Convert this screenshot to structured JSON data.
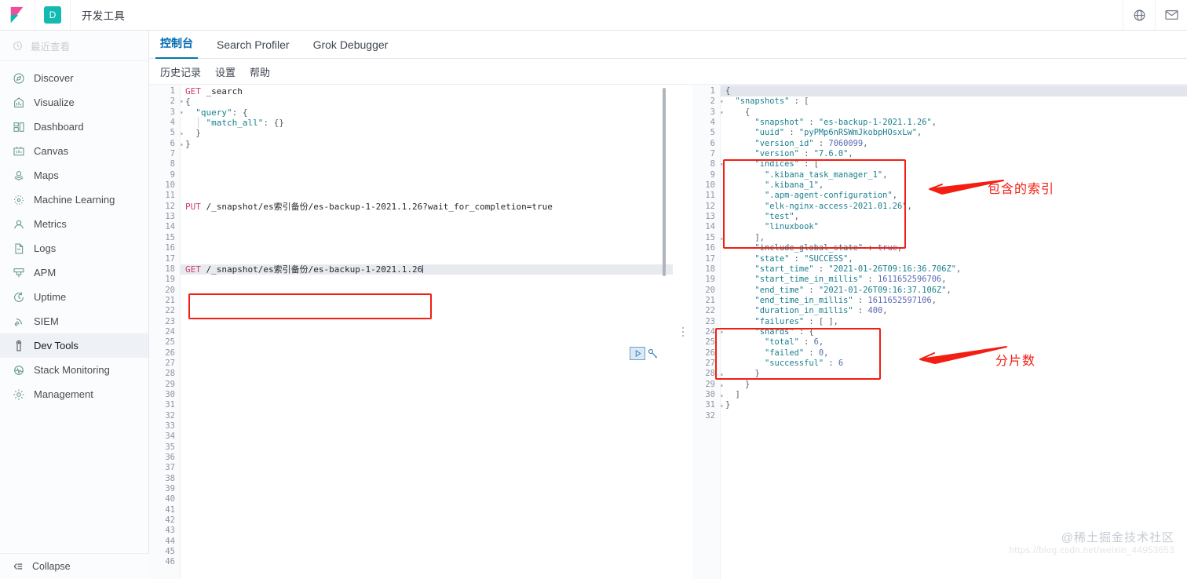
{
  "header": {
    "app_title": "开发工具",
    "space_badge": "D",
    "logo_icon": "kibana-logo-icon",
    "help_icon": "globe-help-icon",
    "mail_icon": "envelope-icon"
  },
  "sidebar": {
    "recent_label": "最近查看",
    "recent_icon": "clock-icon",
    "items": [
      {
        "label": "Discover",
        "icon": "compass-icon",
        "active": false
      },
      {
        "label": "Visualize",
        "icon": "bar-chart-icon",
        "active": false
      },
      {
        "label": "Dashboard",
        "icon": "dashboard-grid-icon",
        "active": false
      },
      {
        "label": "Canvas",
        "icon": "canvas-icon",
        "active": false
      },
      {
        "label": "Maps",
        "icon": "map-marker-icon",
        "active": false
      },
      {
        "label": "Machine Learning",
        "icon": "ml-dots-icon",
        "active": false
      },
      {
        "label": "Metrics",
        "icon": "metrics-gauge-icon",
        "active": false
      },
      {
        "label": "Logs",
        "icon": "logs-icon",
        "active": false
      },
      {
        "label": "APM",
        "icon": "apm-icon",
        "active": false
      },
      {
        "label": "Uptime",
        "icon": "uptime-clock-icon",
        "active": false
      },
      {
        "label": "SIEM",
        "icon": "siem-signal-icon",
        "active": false
      },
      {
        "label": "Dev Tools",
        "icon": "wrench-icon",
        "active": true
      },
      {
        "label": "Stack Monitoring",
        "icon": "monitoring-icon",
        "active": false
      },
      {
        "label": "Management",
        "icon": "gear-icon",
        "active": false
      }
    ],
    "collapse_label": "Collapse",
    "collapse_icon": "collapse-left-icon"
  },
  "tabs": [
    {
      "label": "控制台",
      "active": true
    },
    {
      "label": "Search Profiler",
      "active": false
    },
    {
      "label": "Grok Debugger",
      "active": false
    }
  ],
  "subbar": [
    {
      "label": "历史记录"
    },
    {
      "label": "设置"
    },
    {
      "label": "帮助"
    }
  ],
  "request_editor": {
    "total_visible_lines": 46,
    "lines": [
      {
        "n": 1,
        "fold": "",
        "tokens": [
          {
            "t": "GET ",
            "c": "m"
          },
          {
            "t": "_search",
            "c": "url"
          }
        ]
      },
      {
        "n": 2,
        "fold": "▾",
        "tokens": [
          {
            "t": "{",
            "c": "pun"
          }
        ]
      },
      {
        "n": 3,
        "fold": "▾",
        "tokens": [
          {
            "t": "  \"query\"",
            "c": "key"
          },
          {
            "t": ": {",
            "c": "pun"
          }
        ]
      },
      {
        "n": 4,
        "fold": "",
        "tokens": [
          {
            "t": "  ",
            "c": "pun"
          },
          {
            "t": "│",
            "c": "indent"
          },
          {
            "t": " \"match_all\"",
            "c": "key"
          },
          {
            "t": ": {}",
            "c": "pun"
          }
        ]
      },
      {
        "n": 5,
        "fold": "▴",
        "tokens": [
          {
            "t": "  }",
            "c": "pun"
          }
        ]
      },
      {
        "n": 6,
        "fold": "▴",
        "tokens": [
          {
            "t": "}",
            "c": "pun"
          }
        ]
      },
      {
        "n": 7,
        "fold": "",
        "tokens": []
      },
      {
        "n": 8,
        "fold": "",
        "tokens": []
      },
      {
        "n": 9,
        "fold": "",
        "tokens": []
      },
      {
        "n": 10,
        "fold": "",
        "tokens": []
      },
      {
        "n": 11,
        "fold": "",
        "tokens": []
      },
      {
        "n": 12,
        "fold": "",
        "tokens": [
          {
            "t": "PUT ",
            "c": "m"
          },
          {
            "t": "/_snapshot/es索引备份/es-backup-1-2021.1.26?wait_for_completion=true",
            "c": "url"
          }
        ]
      },
      {
        "n": 13,
        "fold": "",
        "tokens": []
      },
      {
        "n": 14,
        "fold": "",
        "tokens": []
      },
      {
        "n": 15,
        "fold": "",
        "tokens": []
      },
      {
        "n": 16,
        "fold": "",
        "tokens": []
      },
      {
        "n": 17,
        "fold": "",
        "tokens": []
      },
      {
        "n": 18,
        "fold": "",
        "hl": true,
        "caret": true,
        "tokens": [
          {
            "t": "GET ",
            "c": "m"
          },
          {
            "t": "/_snapshot/es索引备份/es-backup-1-2021.1.26",
            "c": "url"
          }
        ]
      },
      {
        "n": 19,
        "fold": "",
        "tokens": []
      },
      {
        "n": 20,
        "fold": "",
        "tokens": []
      },
      {
        "n": 21,
        "fold": "",
        "tokens": []
      },
      {
        "n": 22,
        "fold": "",
        "tokens": []
      },
      {
        "n": 23,
        "fold": "",
        "tokens": []
      },
      {
        "n": 24,
        "fold": "",
        "tokens": []
      },
      {
        "n": 25,
        "fold": "",
        "tokens": []
      },
      {
        "n": 26,
        "fold": "",
        "tokens": []
      },
      {
        "n": 27,
        "fold": "",
        "tokens": []
      },
      {
        "n": 28,
        "fold": "",
        "tokens": []
      },
      {
        "n": 29,
        "fold": "",
        "tokens": []
      },
      {
        "n": 30,
        "fold": "",
        "tokens": []
      },
      {
        "n": 31,
        "fold": "",
        "tokens": []
      },
      {
        "n": 32,
        "fold": "",
        "tokens": []
      },
      {
        "n": 33,
        "fold": "",
        "tokens": []
      },
      {
        "n": 34,
        "fold": "",
        "tokens": []
      },
      {
        "n": 35,
        "fold": "",
        "tokens": []
      },
      {
        "n": 36,
        "fold": "",
        "tokens": []
      },
      {
        "n": 37,
        "fold": "",
        "tokens": []
      },
      {
        "n": 38,
        "fold": "",
        "tokens": []
      },
      {
        "n": 39,
        "fold": "",
        "tokens": []
      },
      {
        "n": 40,
        "fold": "",
        "tokens": []
      },
      {
        "n": 41,
        "fold": "",
        "tokens": []
      },
      {
        "n": 42,
        "fold": "",
        "tokens": []
      },
      {
        "n": 43,
        "fold": "",
        "tokens": []
      },
      {
        "n": 44,
        "fold": "",
        "tokens": []
      },
      {
        "n": 45,
        "fold": "",
        "tokens": []
      },
      {
        "n": 46,
        "fold": "",
        "tokens": []
      }
    ],
    "run_button_icon": "play-triangle-icon",
    "wrench_button_icon": "wrench-icon"
  },
  "response_editor": {
    "lines": [
      {
        "n": 1,
        "fold": "▾",
        "hl": true,
        "tokens": [
          {
            "t": "{",
            "c": "pun"
          }
        ]
      },
      {
        "n": 2,
        "fold": "▾",
        "tokens": [
          {
            "t": "  \"snapshots\"",
            "c": "key"
          },
          {
            "t": " : [",
            "c": "pun"
          }
        ]
      },
      {
        "n": 3,
        "fold": "▾",
        "tokens": [
          {
            "t": "    {",
            "c": "pun"
          }
        ]
      },
      {
        "n": 4,
        "fold": "",
        "tokens": [
          {
            "t": "      \"snapshot\"",
            "c": "key"
          },
          {
            "t": " : ",
            "c": "pun"
          },
          {
            "t": "\"es-backup-1-2021.1.26\"",
            "c": "str"
          },
          {
            "t": ",",
            "c": "pun"
          }
        ]
      },
      {
        "n": 5,
        "fold": "",
        "tokens": [
          {
            "t": "      \"uuid\"",
            "c": "key"
          },
          {
            "t": " : ",
            "c": "pun"
          },
          {
            "t": "\"pyPMp6nRSWmJkobpHOsxLw\"",
            "c": "str"
          },
          {
            "t": ",",
            "c": "pun"
          }
        ]
      },
      {
        "n": 6,
        "fold": "",
        "tokens": [
          {
            "t": "      \"version_id\"",
            "c": "key"
          },
          {
            "t": " : ",
            "c": "pun"
          },
          {
            "t": "7060099",
            "c": "num"
          },
          {
            "t": ",",
            "c": "pun"
          }
        ]
      },
      {
        "n": 7,
        "fold": "",
        "tokens": [
          {
            "t": "      \"version\"",
            "c": "key"
          },
          {
            "t": " : ",
            "c": "pun"
          },
          {
            "t": "\"7.6.0\"",
            "c": "str"
          },
          {
            "t": ",",
            "c": "pun"
          }
        ]
      },
      {
        "n": 8,
        "fold": "▾",
        "tokens": [
          {
            "t": "      \"indices\"",
            "c": "key"
          },
          {
            "t": " : [",
            "c": "pun"
          }
        ]
      },
      {
        "n": 9,
        "fold": "",
        "tokens": [
          {
            "t": "        ",
            "c": "pun"
          },
          {
            "t": "\".kibana_task_manager_1\"",
            "c": "str"
          },
          {
            "t": ",",
            "c": "pun"
          }
        ]
      },
      {
        "n": 10,
        "fold": "",
        "tokens": [
          {
            "t": "        ",
            "c": "pun"
          },
          {
            "t": "\".kibana_1\"",
            "c": "str"
          },
          {
            "t": ",",
            "c": "pun"
          }
        ]
      },
      {
        "n": 11,
        "fold": "",
        "tokens": [
          {
            "t": "        ",
            "c": "pun"
          },
          {
            "t": "\".apm-agent-configuration\"",
            "c": "str"
          },
          {
            "t": ",",
            "c": "pun"
          }
        ]
      },
      {
        "n": 12,
        "fold": "",
        "tokens": [
          {
            "t": "        ",
            "c": "pun"
          },
          {
            "t": "\"elk-nginx-access-2021.01.26\"",
            "c": "str"
          },
          {
            "t": ",",
            "c": "pun"
          }
        ]
      },
      {
        "n": 13,
        "fold": "",
        "tokens": [
          {
            "t": "        ",
            "c": "pun"
          },
          {
            "t": "\"test\"",
            "c": "str"
          },
          {
            "t": ",",
            "c": "pun"
          }
        ]
      },
      {
        "n": 14,
        "fold": "",
        "tokens": [
          {
            "t": "        ",
            "c": "pun"
          },
          {
            "t": "\"linuxbook\"",
            "c": "str"
          }
        ]
      },
      {
        "n": 15,
        "fold": "▴",
        "tokens": [
          {
            "t": "      ],",
            "c": "pun"
          }
        ]
      },
      {
        "n": 16,
        "fold": "",
        "tokens": [
          {
            "t": "      \"include_global_state\"",
            "c": "key"
          },
          {
            "t": " : ",
            "c": "pun"
          },
          {
            "t": "true",
            "c": "bool"
          },
          {
            "t": ",",
            "c": "pun"
          }
        ]
      },
      {
        "n": 17,
        "fold": "",
        "tokens": [
          {
            "t": "      \"state\"",
            "c": "key"
          },
          {
            "t": " : ",
            "c": "pun"
          },
          {
            "t": "\"SUCCESS\"",
            "c": "str"
          },
          {
            "t": ",",
            "c": "pun"
          }
        ]
      },
      {
        "n": 18,
        "fold": "",
        "tokens": [
          {
            "t": "      \"start_time\"",
            "c": "key"
          },
          {
            "t": " : ",
            "c": "pun"
          },
          {
            "t": "\"2021-01-26T09:16:36.706Z\"",
            "c": "str"
          },
          {
            "t": ",",
            "c": "pun"
          }
        ]
      },
      {
        "n": 19,
        "fold": "",
        "tokens": [
          {
            "t": "      \"start_time_in_millis\"",
            "c": "key"
          },
          {
            "t": " : ",
            "c": "pun"
          },
          {
            "t": "1611652596706",
            "c": "num"
          },
          {
            "t": ",",
            "c": "pun"
          }
        ]
      },
      {
        "n": 20,
        "fold": "",
        "tokens": [
          {
            "t": "      \"end_time\"",
            "c": "key"
          },
          {
            "t": " : ",
            "c": "pun"
          },
          {
            "t": "\"2021-01-26T09:16:37.106Z\"",
            "c": "str"
          },
          {
            "t": ",",
            "c": "pun"
          }
        ]
      },
      {
        "n": 21,
        "fold": "",
        "tokens": [
          {
            "t": "      \"end_time_in_millis\"",
            "c": "key"
          },
          {
            "t": " : ",
            "c": "pun"
          },
          {
            "t": "1611652597106",
            "c": "num"
          },
          {
            "t": ",",
            "c": "pun"
          }
        ]
      },
      {
        "n": 22,
        "fold": "",
        "tokens": [
          {
            "t": "      \"duration_in_millis\"",
            "c": "key"
          },
          {
            "t": " : ",
            "c": "pun"
          },
          {
            "t": "400",
            "c": "num"
          },
          {
            "t": ",",
            "c": "pun"
          }
        ]
      },
      {
        "n": 23,
        "fold": "",
        "tokens": [
          {
            "t": "      \"failures\"",
            "c": "key"
          },
          {
            "t": " : [ ],",
            "c": "pun"
          }
        ]
      },
      {
        "n": 24,
        "fold": "▾",
        "tokens": [
          {
            "t": "      \"shards\"",
            "c": "key"
          },
          {
            "t": " : {",
            "c": "pun"
          }
        ]
      },
      {
        "n": 25,
        "fold": "",
        "tokens": [
          {
            "t": "        \"total\"",
            "c": "key"
          },
          {
            "t": " : ",
            "c": "pun"
          },
          {
            "t": "6",
            "c": "num"
          },
          {
            "t": ",",
            "c": "pun"
          }
        ]
      },
      {
        "n": 26,
        "fold": "",
        "tokens": [
          {
            "t": "        \"failed\"",
            "c": "key"
          },
          {
            "t": " : ",
            "c": "pun"
          },
          {
            "t": "0",
            "c": "num"
          },
          {
            "t": ",",
            "c": "pun"
          }
        ]
      },
      {
        "n": 27,
        "fold": "",
        "tokens": [
          {
            "t": "        \"successful\"",
            "c": "key"
          },
          {
            "t": " : ",
            "c": "pun"
          },
          {
            "t": "6",
            "c": "num"
          }
        ]
      },
      {
        "n": 28,
        "fold": "▴",
        "tokens": [
          {
            "t": "      }",
            "c": "pun"
          }
        ]
      },
      {
        "n": 29,
        "fold": "▴",
        "tokens": [
          {
            "t": "    }",
            "c": "pun"
          }
        ]
      },
      {
        "n": 30,
        "fold": "▴",
        "tokens": [
          {
            "t": "  ]",
            "c": "pun"
          }
        ]
      },
      {
        "n": 31,
        "fold": "▴",
        "tokens": [
          {
            "t": "}",
            "c": "pun"
          }
        ]
      },
      {
        "n": 32,
        "fold": "",
        "tokens": []
      }
    ]
  },
  "annotations": {
    "accent_color": "#f31e12",
    "items": [
      {
        "label": "包含的索引",
        "target": "indices-block"
      },
      {
        "label": "分片数",
        "target": "shards-block"
      }
    ]
  },
  "watermark": {
    "text": "@稀土掘金技术社区",
    "url": "https://blog.csdn.net/weixin_44953653"
  }
}
